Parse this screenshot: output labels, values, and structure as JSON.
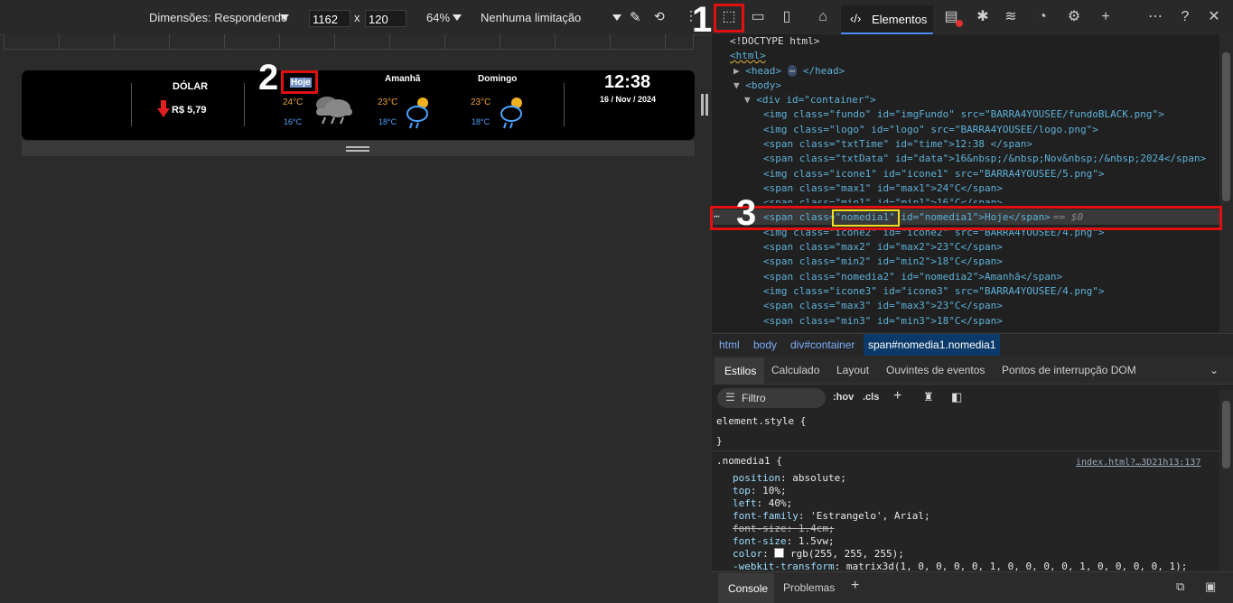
{
  "device_toolbar": {
    "dimensions_label": "Dimensões: Respondendo",
    "width_value": "1162",
    "times": "x",
    "height_value": "120",
    "zoom": "64%",
    "throttle": "Nenhuma limitação"
  },
  "widget": {
    "dolar_label": "DÓLAR",
    "dolar_value": "R$ 5,79",
    "days": [
      {
        "name": "Hoje",
        "max": "24°C",
        "min": "16°C"
      },
      {
        "name": "Amanhã",
        "max": "23°C",
        "min": "18°C"
      },
      {
        "name": "Domingo",
        "max": "23°C",
        "min": "18°C"
      }
    ],
    "time": "12:38",
    "date": "16 / Nov / 2024"
  },
  "annotations": {
    "one": "1",
    "two": "2",
    "three": "3"
  },
  "devtools": {
    "elements_tab": "Elementos",
    "dom_lines": [
      {
        "t": "<!DOCTYPE html>"
      },
      {
        "t": "<html>"
      },
      {
        "t": "<head>"
      },
      {
        "t": "</head>"
      },
      {
        "t": "<body>"
      },
      {
        "t": "<div id=\"container\">"
      },
      {
        "t": "<img class=\"fundo\" id=\"imgFundo\" src=\"BARRA4YOUSEE/fundoBLACK.png\">"
      },
      {
        "t": "<img class=\"logo\" id=\"logo\" src=\"BARRA4YOUSEE/logo.png\">"
      },
      {
        "t": "<span class=\"txtTime\" id=\"time\">12:38 </span>"
      },
      {
        "t": "<span class=\"txtData\" id=\"data\">16&nbsp;/&nbsp;Nov&nbsp;/&nbsp;2024</span>"
      },
      {
        "t": "<img class=\"icone1\" id=\"icone1\" src=\"BARRA4YOUSEE/5.png\">"
      },
      {
        "t": "<span class=\"max1\" id=\"max1\">24°C</span>"
      },
      {
        "t": "<span class=\"min1\" id=\"min1\">16°C</span>"
      },
      {
        "t": "<span class=\"nomedia1\" id=\"nomedia1\">Hoje</span>"
      },
      {
        "t": "== $0"
      },
      {
        "t": "<img class=\"icone2\" id=\"icone2\" src=\"BARRA4YOUSEE/4.png\">"
      },
      {
        "t": "<span class=\"max2\" id=\"max2\">23°C</span>"
      },
      {
        "t": "<span class=\"min2\" id=\"min2\">18°C</span>"
      },
      {
        "t": "<span class=\"nomedia2\" id=\"nomedia2\">Amanhã</span>"
      },
      {
        "t": "<img class=\"icone3\" id=\"icone3\" src=\"BARRA4YOUSEE/4.png\">"
      },
      {
        "t": "<span class=\"max3\" id=\"max3\">23°C</span>"
      },
      {
        "t": "<span class=\"min3\" id=\"min3\">18°C</span>"
      }
    ],
    "breadcrumbs": [
      "html",
      "body",
      "div#container",
      "span#nomedia1.nomedia1"
    ],
    "panel_tabs": [
      "Estilos",
      "Calculado",
      "Layout",
      "Ouvintes de eventos",
      "Pontos de interrupção DOM"
    ],
    "filter_placeholder": "Filtro",
    "hov": ":hov",
    "cls": ".cls",
    "element_style": "element.style {",
    "close_brace": "}",
    "rule_selector": ".nomedia1 {",
    "rule_source": "index.html?…3D21h13:137",
    "props": [
      {
        "n": "position",
        "v": "absolute;"
      },
      {
        "n": "top",
        "v": "10%;"
      },
      {
        "n": "left",
        "v": "40%;"
      },
      {
        "n": "font-family",
        "v": "'Estrangelo', Arial;"
      },
      {
        "n": "font-size",
        "v": "1.4cm;"
      },
      {
        "n": "font-size",
        "v": "1.5vw;"
      },
      {
        "n": "color",
        "v": "rgb(255, 255, 255);"
      },
      {
        "n": "-webkit-transform",
        "v": "matrix3d(1, 0, 0, 0, 0, 1, 0, 0, 0, 0, 1, 0, 0, 0, 0, 1);"
      }
    ],
    "console_tab": "Console",
    "problems_tab": "Problemas"
  }
}
